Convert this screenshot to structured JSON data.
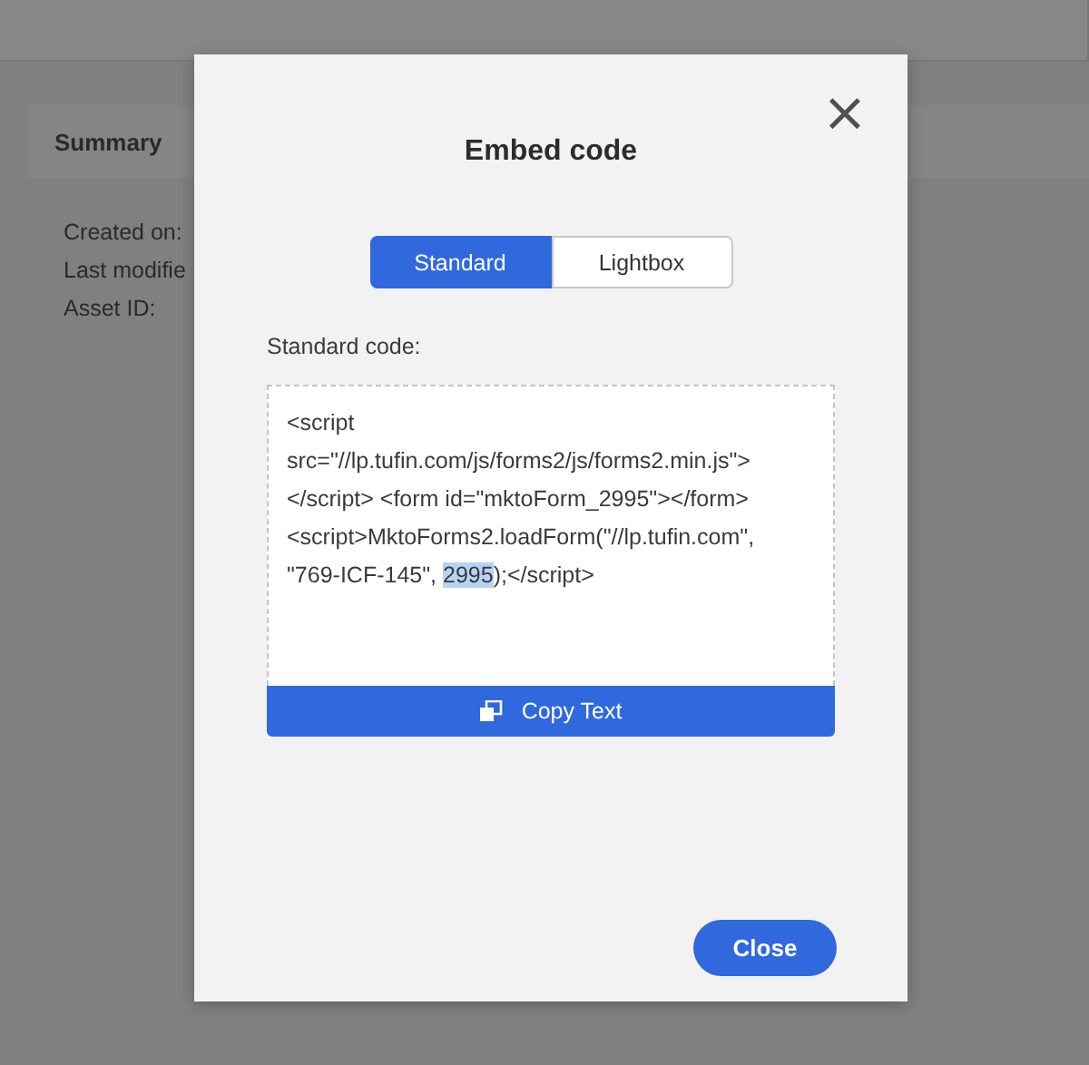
{
  "page": {
    "summary_title": "Summary",
    "fields": [
      "Created on:",
      "Last modifie",
      "Asset ID:"
    ]
  },
  "dialog": {
    "title": "Embed code",
    "close_icon": "×",
    "tabs": [
      {
        "label": "Standard",
        "selected": true
      },
      {
        "label": "Lightbox",
        "selected": false
      }
    ],
    "code_label": "Standard code:",
    "code": {
      "text_before": "<script src=\"//lp.tufin.com/js/forms2/js/forms2.min.js\"></script> <form id=\"mktoForm_2995\"></form> <script>MktoForms2.loadForm(\"//lp.tufin.com\", \"769-ICF-145\", ",
      "selected_text": "2995",
      "text_after": ");</script>"
    },
    "copy_button": "Copy Text",
    "close_button": "Close"
  }
}
